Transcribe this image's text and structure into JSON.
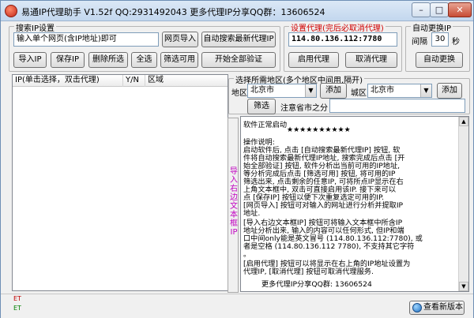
{
  "window": {
    "title": "易通IP代理助手 V1.52f  QQ:2931492043   更多代理IP分享QQ群：13606524",
    "min_glyph": "–",
    "max_glyph": "□",
    "close_glyph": "✕"
  },
  "search_group": {
    "legend": "搜索IP设置",
    "url_input_value": "输入单个网页(含IP地址)即可",
    "import_page_button": "网页导入",
    "auto_search_button": "自动搜索最新代理IP",
    "import_ip_button": "导入IP",
    "save_ip_button": "保存IP",
    "delete_selected_button": "删除所选",
    "select_all_button": "全选",
    "filter_usable_button": "筛选可用",
    "verify_all_button": "开始全部验证"
  },
  "proxy_group": {
    "legend": "设置代理(完后必取消代理)",
    "proxy_value": "114.80.136.112:7780",
    "enable_button": "启用代理",
    "cancel_button": "取消代理"
  },
  "auto_change_group": {
    "legend": "自动更换IP",
    "interval_label": "间隔",
    "interval_value": "30",
    "seconds_label": "秒",
    "auto_change_button": "自动更换"
  },
  "region_group": {
    "legend": "选择所需地区(多个地区中间用,隔开)",
    "region_label": "地区",
    "region_value": "北京市",
    "add_button_1": "添加",
    "city_label": "城区",
    "city_value": "北京市",
    "add_button_2": "添加",
    "filter_button": "筛选",
    "notice_label": "注意省市之分"
  },
  "ip_list": {
    "columns": [
      "IP(单击选择，双击代理)",
      "Y/N",
      "区域"
    ]
  },
  "side_label": "导入右边文本框IP",
  "log": {
    "lines": [
      "软件正常启动",
      "操作说明:",
      "启动软件后, 点击 [自动搜索最新代理IP] 按钮, 软",
      "件将自动搜索最新代理IP地址, 搜索完成后点击 [开",
      "始全部验证] 按钮, 软件分析出当前可用的IP地址,",
      "等分析完成后点击 [筛选可用] 按钮, 将可用的IP",
      "筛选出来, 点击剩余的任意IP, 可将所点IP显示在右",
      "上角文本框中, 双击可直接启用该IP. 接下来可以",
      "点 [保存IP] 按钮以便下次重复选定可用的IP.",
      "[网页导入] 按钮可对输入的网址进行分析并提取IP",
      "地址.",
      "[导入右边文本框IP] 按钮可将输入文本框中所含IP",
      "地址分析出来, 输入的内容可以任何形式, 但IP和端",
      "口中间only能是英文冒号 (114.80.136.112:7780), 或",
      "者是空格 (114.80.136.112 7780), 不支持其它字符",
      "。",
      "[启用代理] 按钮可以将显示在右上角的IP地址设置为",
      "代理IP, [取消代理] 按钮可取消代理服务.",
      "更多代理IP分享QQ群: 13606524"
    ],
    "stars": "★★★★★★★★★★"
  },
  "status": {
    "et_top": "ET",
    "et_bottom": "ET",
    "check_version_button": "查看新版本"
  }
}
